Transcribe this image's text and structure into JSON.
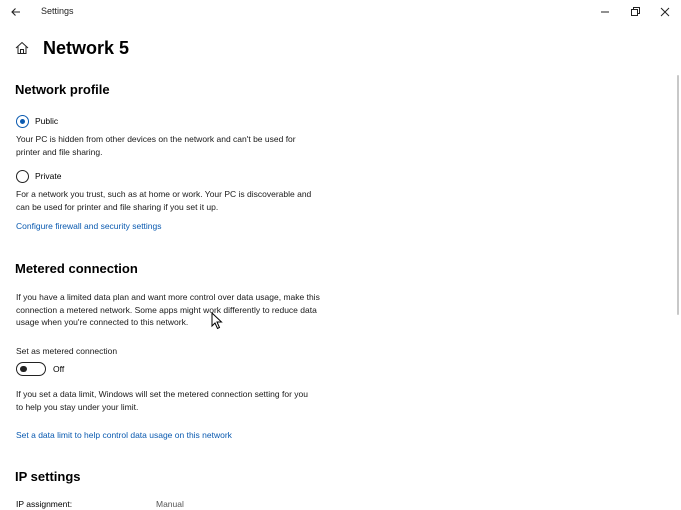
{
  "window": {
    "title": "Settings"
  },
  "page": {
    "title": "Network 5"
  },
  "network_profile": {
    "heading": "Network profile",
    "options": [
      {
        "label": "Public",
        "checked": true,
        "description": "Your PC is hidden from other devices on the network and can't be used for printer and file sharing."
      },
      {
        "label": "Private",
        "checked": false,
        "description": "For a network you trust, such as at home or work. Your PC is discoverable and can be used for printer and file sharing if you set it up."
      }
    ],
    "firewall_link": "Configure firewall and security settings"
  },
  "metered": {
    "heading": "Metered connection",
    "description": "If you have a limited data plan and want more control over data usage, make this connection a metered network. Some apps might work differently to reduce data usage when you're connected to this network.",
    "toggle_label": "Set as metered connection",
    "toggle_state": "Off",
    "data_limit_note": "If you set a data limit, Windows will set the metered connection setting for you to help you stay under your limit.",
    "data_limit_link": "Set a data limit to help control data usage on this network"
  },
  "ip_settings": {
    "heading": "IP settings",
    "assignment_label": "IP assignment:",
    "assignment_value": "Manual"
  },
  "icons": {
    "back": "back-arrow-icon",
    "home": "home-icon",
    "minimize": "minimize-icon",
    "maximize": "restore-icon",
    "close": "close-icon"
  },
  "colors": {
    "accent": "#0a5ab0",
    "text": "#000000",
    "background": "#ffffff"
  }
}
